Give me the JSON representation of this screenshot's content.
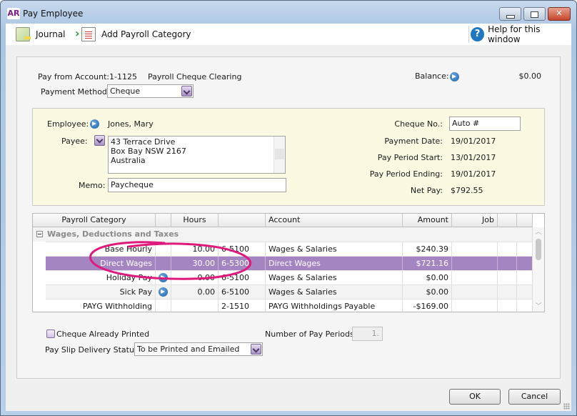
{
  "window": {
    "app_logo": "AR",
    "title": "Pay Employee",
    "controls": {
      "minimize": "minimize",
      "maximize": "maximize",
      "close": "✕"
    }
  },
  "toolbar": {
    "journal_label": "Journal",
    "add_category_label": "Add Payroll Category",
    "help_label": "Help for this window",
    "help_glyph": "?"
  },
  "header": {
    "pay_from_label": "Pay from Account:",
    "pay_from_account_no": "1-1125",
    "pay_from_account_name": "Payroll Cheque Clearing",
    "payment_method_label": "Payment Method:",
    "payment_method_value": "Cheque",
    "balance_label": "Balance:",
    "balance_value": "$0.00"
  },
  "employee_panel": {
    "employee_label": "Employee:",
    "employee_value": "Jones, Mary",
    "payee_label": "Payee:",
    "payee_lines": [
      "43 Terrace Drive",
      "Box Bay  NSW  2167",
      "Australia"
    ],
    "memo_label": "Memo:",
    "memo_value": "Paycheque",
    "cheque_no_label": "Cheque No.:",
    "cheque_no_value": "Auto #",
    "payment_date_label": "Payment Date:",
    "payment_date_value": "19/01/2017",
    "period_start_label": "Pay Period Start:",
    "period_start_value": "13/01/2017",
    "period_end_label": "Pay Period Ending:",
    "period_end_value": "19/01/2017",
    "net_pay_label": "Net Pay:",
    "net_pay_value": "$792.55"
  },
  "grid": {
    "columns": [
      "Payroll Category",
      "",
      "Hours",
      "",
      "Account",
      "Amount",
      "Job",
      "",
      ""
    ],
    "group_label": "Wages, Deductions and Taxes",
    "selected_color": "#a585c1",
    "rows": [
      {
        "category": "Base Hourly",
        "has_arrow": false,
        "hours": "10.00",
        "account_no": "6-5100",
        "account": "Wages & Salaries",
        "amount": "$240.39",
        "job": "",
        "selected": false
      },
      {
        "category": "Direct Wages",
        "has_arrow": false,
        "hours": "30.00",
        "account_no": "6-5300",
        "account": "Direct Wages",
        "amount": "$721.16",
        "job": "",
        "selected": true
      },
      {
        "category": "Holiday Pay",
        "has_arrow": true,
        "hours": "0.00",
        "account_no": "6-5100",
        "account": "Wages & Salaries",
        "amount": "$0.00",
        "job": "",
        "selected": false
      },
      {
        "category": "Sick Pay",
        "has_arrow": true,
        "hours": "0.00",
        "account_no": "6-5100",
        "account": "Wages & Salaries",
        "amount": "$0.00",
        "job": "",
        "selected": false
      },
      {
        "category": "PAYG Withholding",
        "has_arrow": false,
        "hours": "",
        "account_no": "2-1510",
        "account": "PAYG Withholdings Payable",
        "amount": "-$169.00",
        "job": "",
        "selected": false
      }
    ]
  },
  "footer": {
    "cheque_printed_label": "Cheque Already Printed",
    "cheque_printed_checked": false,
    "num_periods_label": "Number of Pay Periods:",
    "num_periods_value": "1.",
    "pay_slip_label": "Pay Slip Delivery Status:",
    "pay_slip_value": "To be Printed and Emailed",
    "ok_label": "OK",
    "cancel_label": "Cancel"
  },
  "annotation": {
    "color": "#e0197d",
    "description": "hand-drawn circle around Direct Wages row"
  }
}
